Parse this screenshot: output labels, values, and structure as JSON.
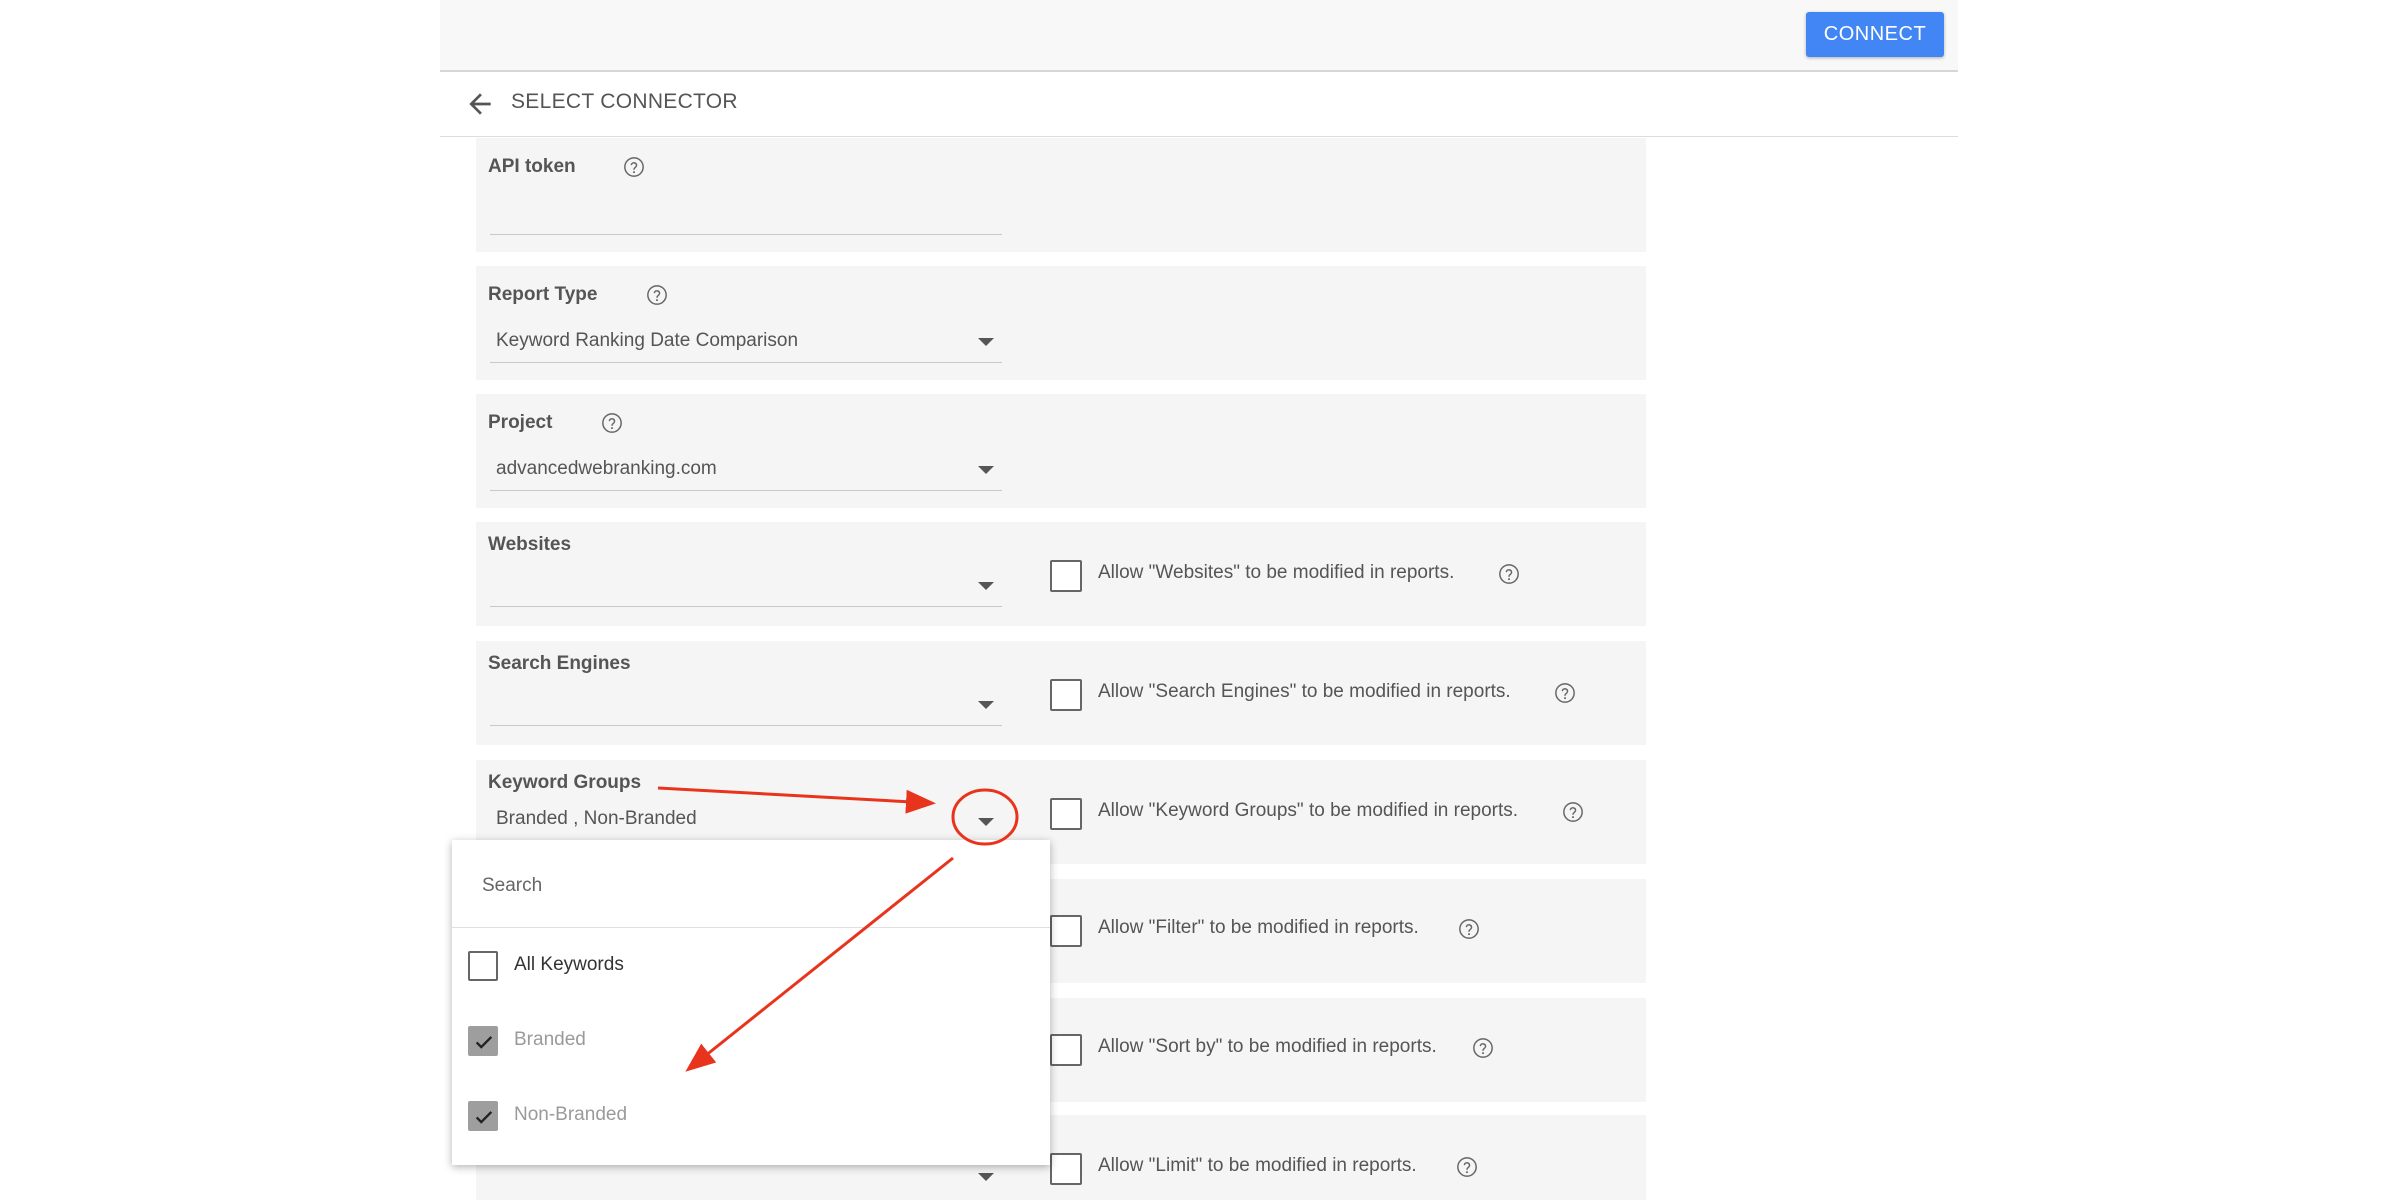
{
  "header": {
    "connect_label": "CONNECT"
  },
  "subheader": {
    "title": "SELECT CONNECTOR"
  },
  "form": {
    "api_token": {
      "label": "API token",
      "value": ""
    },
    "report_type": {
      "label": "Report Type",
      "value": "Keyword Ranking Date Comparison"
    },
    "project": {
      "label": "Project",
      "value": "advancedwebranking.com"
    },
    "websites": {
      "label": "Websites",
      "value": "",
      "allow_label": "Allow \"Websites\" to be modified in reports.",
      "allow_checked": false
    },
    "search_engines": {
      "label": "Search Engines",
      "value": "",
      "allow_label": "Allow \"Search Engines\" to be modified in reports.",
      "allow_checked": false
    },
    "keyword_groups": {
      "label": "Keyword Groups",
      "value": "Branded , Non-Branded",
      "allow_label": "Allow \"Keyword Groups\" to be modified in reports.",
      "allow_checked": false
    },
    "filter": {
      "allow_label": "Allow \"Filter\" to be modified in reports.",
      "allow_checked": false
    },
    "sort_by": {
      "allow_label": "Allow \"Sort by\" to be modified in reports.",
      "allow_checked": false
    },
    "limit": {
      "allow_label": "Allow \"Limit\" to be modified in reports.",
      "allow_checked": false
    }
  },
  "dropdown": {
    "search_placeholder": "Search",
    "options": [
      {
        "label": "All Keywords",
        "checked": false
      },
      {
        "label": "Branded",
        "checked": true
      },
      {
        "label": "Non-Branded",
        "checked": true
      }
    ]
  },
  "colors": {
    "primary": "#4285f4",
    "card_bg": "#f5f5f5",
    "annotation": "#e8341c"
  }
}
